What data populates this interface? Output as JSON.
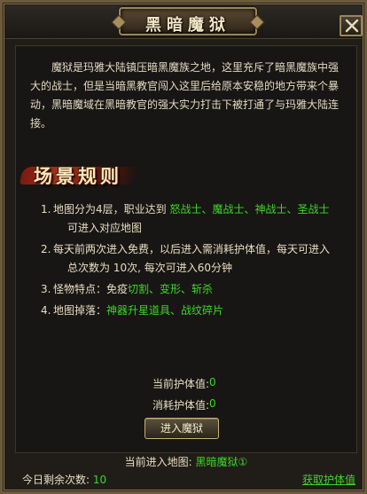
{
  "window": {
    "title": "黑暗魔狱",
    "close_icon": "close-icon"
  },
  "intro_text": "魔狱是玛雅大陆镇压暗黑魔族之地，这里充斥了暗黑魔族中强大的战士，但是当暗黑教官闯入这里后给原本安稳的地方带来个暴动，黑暗魔域在黑暗教官的强大实力打击下被打通了与玛雅大陆连接。",
  "rules_heading": "场景规则",
  "rules": {
    "r1_num": "1.",
    "r1_text": "地图分为4层，职业达到",
    "r1_classes": "怒战士、魔战士、神战士、圣战士",
    "r1_cont": "可进入对应地图",
    "r2_num": "2.",
    "r2_text": "每天前两次进入免费，以后进入需消耗护体值，每天可进入",
    "r2_cont": "总次数为 10次, 每次可进入60分钟",
    "r3_num": "3.",
    "r3_text": "怪物特点：免疫",
    "r3_traits": "切割、变形、斩杀",
    "r4_num": "4.",
    "r4_text": "地图掉落：",
    "r4_drops": "神器升星道具、战纹碎片"
  },
  "stats": {
    "current_label": "当前护体值:",
    "current_value": "0",
    "cost_label": "消耗护体值:",
    "cost_value": "0"
  },
  "enter_button": "进入魔狱",
  "current_map_label": "当前进入地图:",
  "current_map_value": "黑暗魔狱①",
  "remaining_label": "今日剩余次数:",
  "remaining_value": "10",
  "get_stamina_link": "获取护体值",
  "colors": {
    "highlight": "#3ed62a",
    "text": "#e6dcc0",
    "frame": "#9c855a"
  }
}
